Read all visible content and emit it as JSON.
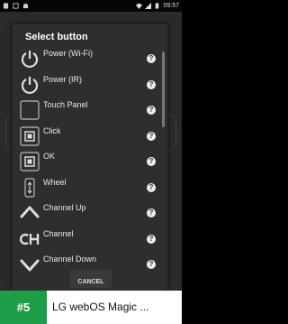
{
  "status_bar": {
    "left_icons": [
      "sim-card-icon",
      "notification-icon",
      "android-icon"
    ],
    "right_icons": [
      "wifi-icon",
      "signal-icon",
      "battery-icon"
    ],
    "time": "09:57"
  },
  "dialog": {
    "title": "Select button",
    "items": [
      {
        "label": "Power (Wi-Fi)",
        "icon": "power-icon"
      },
      {
        "label": "Power (IR)",
        "icon": "power-icon"
      },
      {
        "label": "Touch Panel",
        "icon": "touch-panel-icon"
      },
      {
        "label": "Click",
        "icon": "click-icon"
      },
      {
        "label": "OK",
        "icon": "ok-icon"
      },
      {
        "label": "Wheel",
        "icon": "wheel-icon"
      },
      {
        "label": "Channel Up",
        "icon": "chevron-up-icon"
      },
      {
        "label": "Channel",
        "icon": "channel-icon"
      },
      {
        "label": "Channel Down",
        "icon": "chevron-down-icon"
      }
    ],
    "help_glyph": "?",
    "cancel_label": "CANCEL"
  },
  "banner": {
    "rank": "#5",
    "title": "LG webOS Magic ..."
  },
  "colors": {
    "banner_rank_bg": "#1e9e48",
    "dialog_bg": "#2e2e2e"
  }
}
